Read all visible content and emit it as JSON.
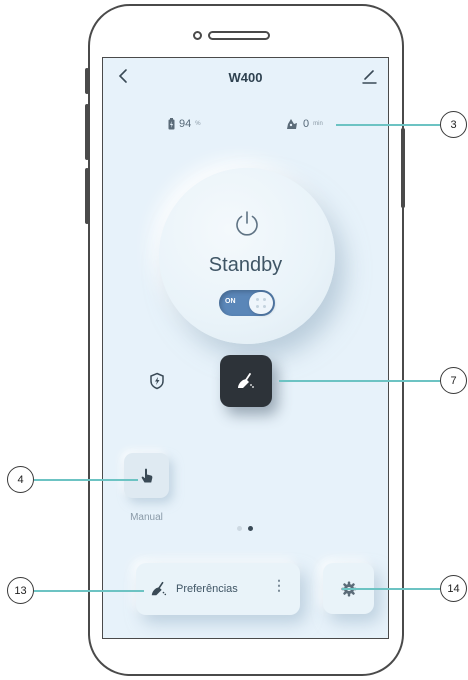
{
  "header": {
    "title": "W400",
    "back_icon": "chevron-left-icon",
    "edit_icon": "pencil-icon"
  },
  "stats": {
    "battery": {
      "icon": "battery-icon",
      "value": "94",
      "unit": "%"
    },
    "time": {
      "icon": "cleaning-time-icon",
      "value": "0",
      "unit": "min"
    }
  },
  "power": {
    "icon": "power-icon",
    "status": "Standby",
    "toggle_label": "ON"
  },
  "modes": {
    "shield_icon": "shield-bolt-icon",
    "active_icon": "broom-icon",
    "manual": {
      "icon": "hand-pointer-icon",
      "label": "Manual"
    }
  },
  "pager": {
    "count": 2,
    "active": 2
  },
  "preferences": {
    "icon": "broom-icon",
    "label": "Preferências",
    "more": "⋮"
  },
  "settings": {
    "icon": "gear-icon"
  },
  "callouts": {
    "c3": "3",
    "c7": "7",
    "c4": "4",
    "c13": "13",
    "c14": "14"
  },
  "colors": {
    "accent": "#6cc3c3",
    "screen_bg": "#e7f2fa",
    "dark_button": "#2d3339",
    "toggle": "#5a86b8"
  }
}
